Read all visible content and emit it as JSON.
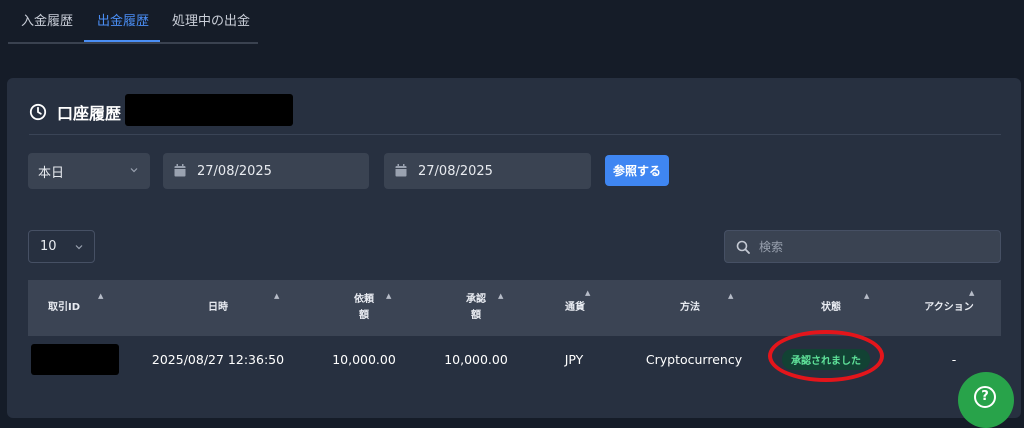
{
  "tabs": [
    {
      "label": "入金履歴",
      "active": false
    },
    {
      "label": "出金履歴",
      "active": true
    },
    {
      "label": "処理中の出金",
      "active": false
    }
  ],
  "card": {
    "title": "口座履歴",
    "icon": "clock-icon"
  },
  "filters": {
    "period_selected": "本日",
    "date_from": "27/08/2025",
    "date_to": "27/08/2025",
    "search_button": "参照する"
  },
  "table_controls": {
    "page_size": "10",
    "search_placeholder": "検索"
  },
  "table": {
    "columns": [
      "取引ID",
      "日時",
      "依頼額",
      "承認額",
      "通貨",
      "方法",
      "状態",
      "アクション"
    ],
    "rows": [
      {
        "transaction_id": "",
        "datetime": "2025/08/27 12:36:50",
        "requested_amount": "10,000.00",
        "approved_amount": "10,000.00",
        "currency": "JPY",
        "method": "Cryptocurrency",
        "status": "承認されました",
        "action": "-"
      }
    ]
  },
  "colors": {
    "background": "#151c28",
    "card": "#273040",
    "accent": "#4a8ef5",
    "status_approved_text": "#5fe39a",
    "status_approved_bg": "#124234",
    "highlight": "#e4151b",
    "help_button": "#28a34a"
  },
  "help_button": {
    "icon": "question-icon"
  }
}
